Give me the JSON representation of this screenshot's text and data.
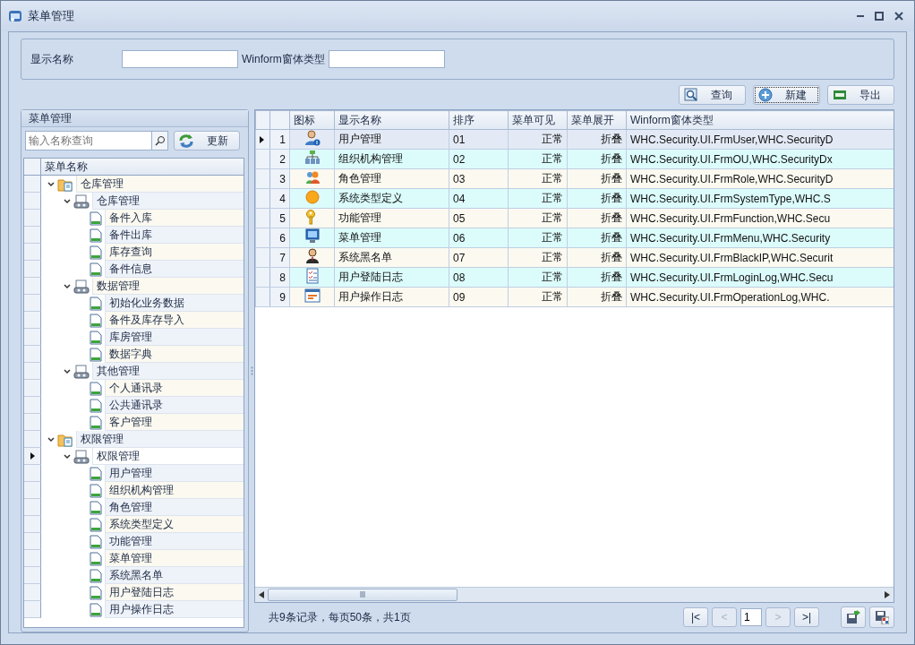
{
  "window": {
    "title": "菜单管理"
  },
  "search": {
    "fields": [
      {
        "label": "显示名称"
      },
      {
        "label": "Winform窗体类型"
      }
    ]
  },
  "toolbar": {
    "buttons": [
      {
        "label": "查询",
        "kind": "query",
        "focused": false
      },
      {
        "label": "新建",
        "kind": "add",
        "focused": true
      },
      {
        "label": "导出",
        "kind": "export",
        "focused": false
      }
    ]
  },
  "tree_panel": {
    "title": "菜单管理",
    "search": {
      "placeholder": "输入名称查询"
    },
    "refresh_button": "更新",
    "column": "菜单名称",
    "nodes": [
      {
        "label": "仓库管理",
        "kind": "folder",
        "expanded": true,
        "selected": false,
        "children": [
          {
            "label": "仓库管理",
            "kind": "module",
            "expanded": true,
            "selected": false,
            "children": [
              {
                "label": "备件入库",
                "kind": "page",
                "selected": false
              },
              {
                "label": "备件出库",
                "kind": "page",
                "selected": false
              },
              {
                "label": "库存查询",
                "kind": "page",
                "selected": false
              },
              {
                "label": "备件信息",
                "kind": "page",
                "selected": false
              }
            ]
          },
          {
            "label": "数据管理",
            "kind": "module",
            "expanded": true,
            "selected": false,
            "children": [
              {
                "label": "初始化业务数据",
                "kind": "page",
                "selected": false
              },
              {
                "label": "备件及库存导入",
                "kind": "page",
                "selected": false
              },
              {
                "label": "库房管理",
                "kind": "page",
                "selected": false
              },
              {
                "label": "数据字典",
                "kind": "page",
                "selected": false
              }
            ]
          },
          {
            "label": "其他管理",
            "kind": "module",
            "expanded": true,
            "selected": false,
            "children": [
              {
                "label": "个人通讯录",
                "kind": "page",
                "selected": false
              },
              {
                "label": "公共通讯录",
                "kind": "page",
                "selected": false
              },
              {
                "label": "客户管理",
                "kind": "page",
                "selected": false
              }
            ]
          }
        ]
      },
      {
        "label": "权限管理",
        "kind": "folder",
        "expanded": true,
        "selected": false,
        "children": [
          {
            "label": "权限管理",
            "kind": "module",
            "expanded": true,
            "selected": true,
            "children": [
              {
                "label": "用户管理",
                "kind": "page",
                "selected": false
              },
              {
                "label": "组织机构管理",
                "kind": "page",
                "selected": false
              },
              {
                "label": "角色管理",
                "kind": "page",
                "selected": false
              },
              {
                "label": "系统类型定义",
                "kind": "page",
                "selected": false
              },
              {
                "label": "功能管理",
                "kind": "page",
                "selected": false
              },
              {
                "label": "菜单管理",
                "kind": "page",
                "selected": false
              },
              {
                "label": "系统黑名单",
                "kind": "page",
                "selected": false
              },
              {
                "label": "用户登陆日志",
                "kind": "page",
                "selected": false
              },
              {
                "label": "用户操作日志",
                "kind": "page",
                "selected": false
              }
            ]
          }
        ]
      }
    ]
  },
  "table": {
    "columns": [
      "图标",
      "显示名称",
      "排序",
      "菜单可见",
      "菜单展开",
      "Winform窗体类型"
    ],
    "rows": [
      {
        "row_number": "1",
        "name": "用户管理",
        "order": "01",
        "visible": "正常",
        "expand": "折叠",
        "winform": "WHC.Security.UI.FrmUser,WHC.SecurityD",
        "selected": true
      },
      {
        "row_number": "2",
        "name": "组织机构管理",
        "order": "02",
        "visible": "正常",
        "expand": "折叠",
        "winform": "WHC.Security.UI.FrmOU,WHC.SecurityDx",
        "selected": false
      },
      {
        "row_number": "3",
        "name": "角色管理",
        "order": "03",
        "visible": "正常",
        "expand": "折叠",
        "winform": "WHC.Security.UI.FrmRole,WHC.SecurityD",
        "selected": false
      },
      {
        "row_number": "4",
        "name": "系统类型定义",
        "order": "04",
        "visible": "正常",
        "expand": "折叠",
        "winform": "WHC.Security.UI.FrmSystemType,WHC.S",
        "selected": false
      },
      {
        "row_number": "5",
        "name": "功能管理",
        "order": "05",
        "visible": "正常",
        "expand": "折叠",
        "winform": "WHC.Security.UI.FrmFunction,WHC.Secu",
        "selected": false
      },
      {
        "row_number": "6",
        "name": "菜单管理",
        "order": "06",
        "visible": "正常",
        "expand": "折叠",
        "winform": "WHC.Security.UI.FrmMenu,WHC.Security",
        "selected": false
      },
      {
        "row_number": "7",
        "name": "系统黑名单",
        "order": "07",
        "visible": "正常",
        "expand": "折叠",
        "winform": "WHC.Security.UI.FrmBlackIP,WHC.Securit",
        "selected": false
      },
      {
        "row_number": "8",
        "name": "用户登陆日志",
        "order": "08",
        "visible": "正常",
        "expand": "折叠",
        "winform": "WHC.Security.UI.FrmLoginLog,WHC.Secu",
        "selected": false
      },
      {
        "row_number": "9",
        "name": "用户操作日志",
        "order": "09",
        "visible": "正常",
        "expand": "折叠",
        "winform": "WHC.Security.UI.FrmOperationLog,WHC.",
        "selected": false
      }
    ]
  },
  "pager": {
    "summary": "共9条记录，每页50条，共1页",
    "buttons": [
      {
        "label": "|<",
        "disabled": false
      },
      {
        "label": "<",
        "disabled": true
      }
    ],
    "page": "1",
    "next_buttons": [
      {
        "label": ">",
        "disabled": true
      },
      {
        "label": ">|",
        "disabled": false
      }
    ]
  }
}
